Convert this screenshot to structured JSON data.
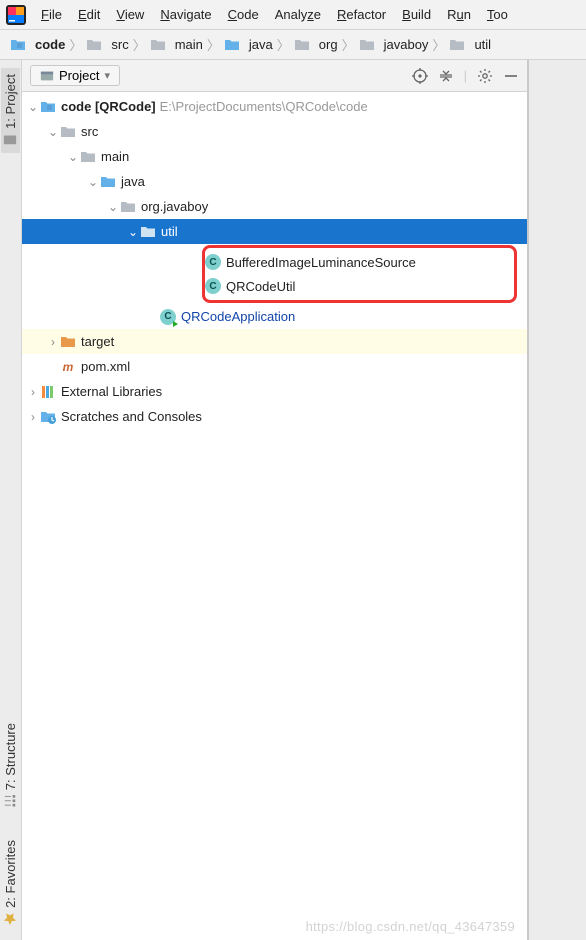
{
  "menubar": {
    "items": [
      "File",
      "Edit",
      "View",
      "Navigate",
      "Code",
      "Analyze",
      "Refactor",
      "Build",
      "Run",
      "Too"
    ]
  },
  "breadcrumb": {
    "segments": [
      "code",
      "src",
      "main",
      "java",
      "org",
      "javaboy",
      "util"
    ]
  },
  "left_gutter": {
    "project": "1: Project",
    "structure": "7: Structure",
    "favorites": "2: Favorites"
  },
  "panel": {
    "title": "Project",
    "dropdown_glyph": "▾"
  },
  "tree": {
    "root": {
      "name": "code",
      "qual": "[QRCode]",
      "path": "E:\\ProjectDocuments\\QRCode\\code"
    },
    "src": "src",
    "main": "main",
    "java": "java",
    "pkg": "org.javaboy",
    "util": "util",
    "class1": "BufferedImageLuminanceSource",
    "class2": "QRCodeUtil",
    "app_class": "QRCodeApplication",
    "target": "target",
    "pom": "pom.xml",
    "ext": "External Libraries",
    "scratch": "Scratches and Consoles"
  },
  "watermark": "https://blog.csdn.net/qq_43647359"
}
